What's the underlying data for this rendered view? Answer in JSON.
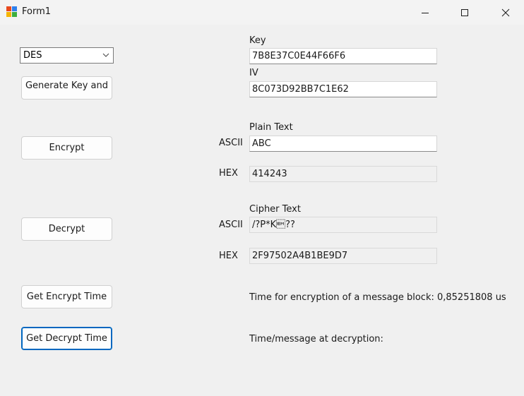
{
  "window": {
    "title": "Form1",
    "minimize_icon": "minimize-icon",
    "maximize_icon": "maximize-icon",
    "close_icon": "close-icon"
  },
  "algorithm_select": {
    "selected": "DES"
  },
  "buttons": {
    "generate": "Generate Key and",
    "encrypt": "Encrypt",
    "decrypt": "Decrypt",
    "get_encrypt_time": "Get Encrypt Time",
    "get_decrypt_time": "Get Decrypt Time"
  },
  "key": {
    "label": "Key",
    "value": "7B8E37C0E44F66F6"
  },
  "iv": {
    "label": "IV",
    "value": "8C073D92BB7C1E62"
  },
  "plain": {
    "label": "Plain Text",
    "ascii_label": "ASCII",
    "ascii_value": "ABC",
    "hex_label": "HEX",
    "hex_value": "414243"
  },
  "cipher": {
    "label": "Cipher Text",
    "ascii_label": "ASCII",
    "ascii_value": "/?P*K\u0019??",
    "hex_label": "HEX",
    "hex_value": "2F97502A4B1BE9D7"
  },
  "timing": {
    "encrypt_text": "Time for encryption of a message block: 0,85251808 us",
    "decrypt_text": "Time/message at decryption:"
  }
}
